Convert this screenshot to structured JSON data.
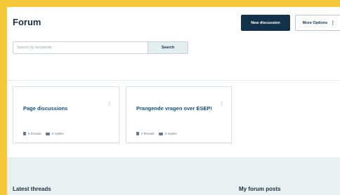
{
  "header": {
    "title": "Forum",
    "new_discussion_label": "New discussion",
    "more_options_label": "More Options"
  },
  "search": {
    "placeholder": "Search by keywords",
    "value": "",
    "button_label": "Search"
  },
  "cards": [
    {
      "title": "Page discussions",
      "threads": "5 threads",
      "replies": "0 replies"
    },
    {
      "title": "Prangende vragen over ESEP!",
      "threads": "0 threads",
      "replies": "0 replies"
    }
  ],
  "sections": {
    "latest_threads": "Latest threads",
    "my_forum_posts": "My forum posts"
  },
  "colors": {
    "frame": "#f6c93a",
    "primary_button": "#12324a",
    "link": "#0d4f86",
    "panel": "#e8f0f2"
  },
  "icons": {
    "more_options": "kebab-icon",
    "card_menu": "kebab-icon",
    "threads": "thread-icon",
    "replies": "reply-icon"
  }
}
